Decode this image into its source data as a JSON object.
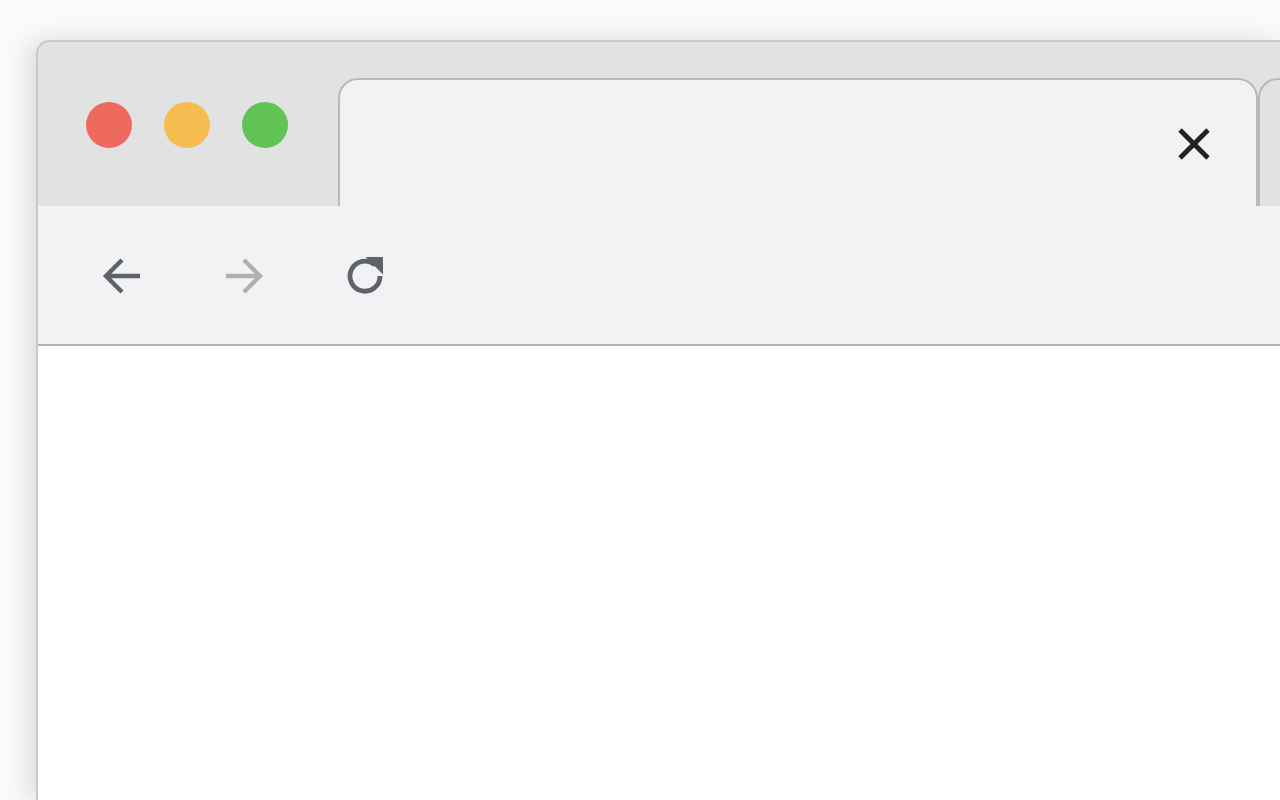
{
  "tabs": [
    {
      "selected": true
    }
  ],
  "toolbar": {
    "buttons": [
      {
        "kind": "back",
        "disabled": false
      },
      {
        "kind": "forward",
        "disabled": true
      },
      {
        "kind": "reload",
        "disabled": false
      }
    ]
  }
}
